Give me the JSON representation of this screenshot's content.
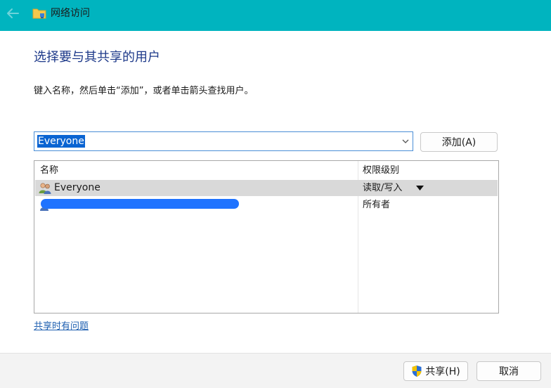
{
  "window": {
    "title": "网络访问"
  },
  "heading": "选择要与其共享的用户",
  "instruction": "键入名称，然后单击“添加”，或者单击箭头查找用户。",
  "user_input": {
    "value": "Everyone"
  },
  "add_button": {
    "label": "添加(A)"
  },
  "list": {
    "columns": [
      "名称",
      "权限级别"
    ],
    "rows": [
      {
        "name": "Everyone",
        "permission": "读取/写入",
        "selected": true
      },
      {
        "name": "",
        "permission": "所有者",
        "selected": false
      }
    ]
  },
  "help_link": "共享时有问题",
  "footer": {
    "share_label": "共享(H)",
    "cancel_label": "取消"
  },
  "colors": {
    "titlebar": "#00b4bf",
    "heading": "#1e3a8a",
    "selection": "#0a64d2",
    "link": "#1e5fb0"
  }
}
